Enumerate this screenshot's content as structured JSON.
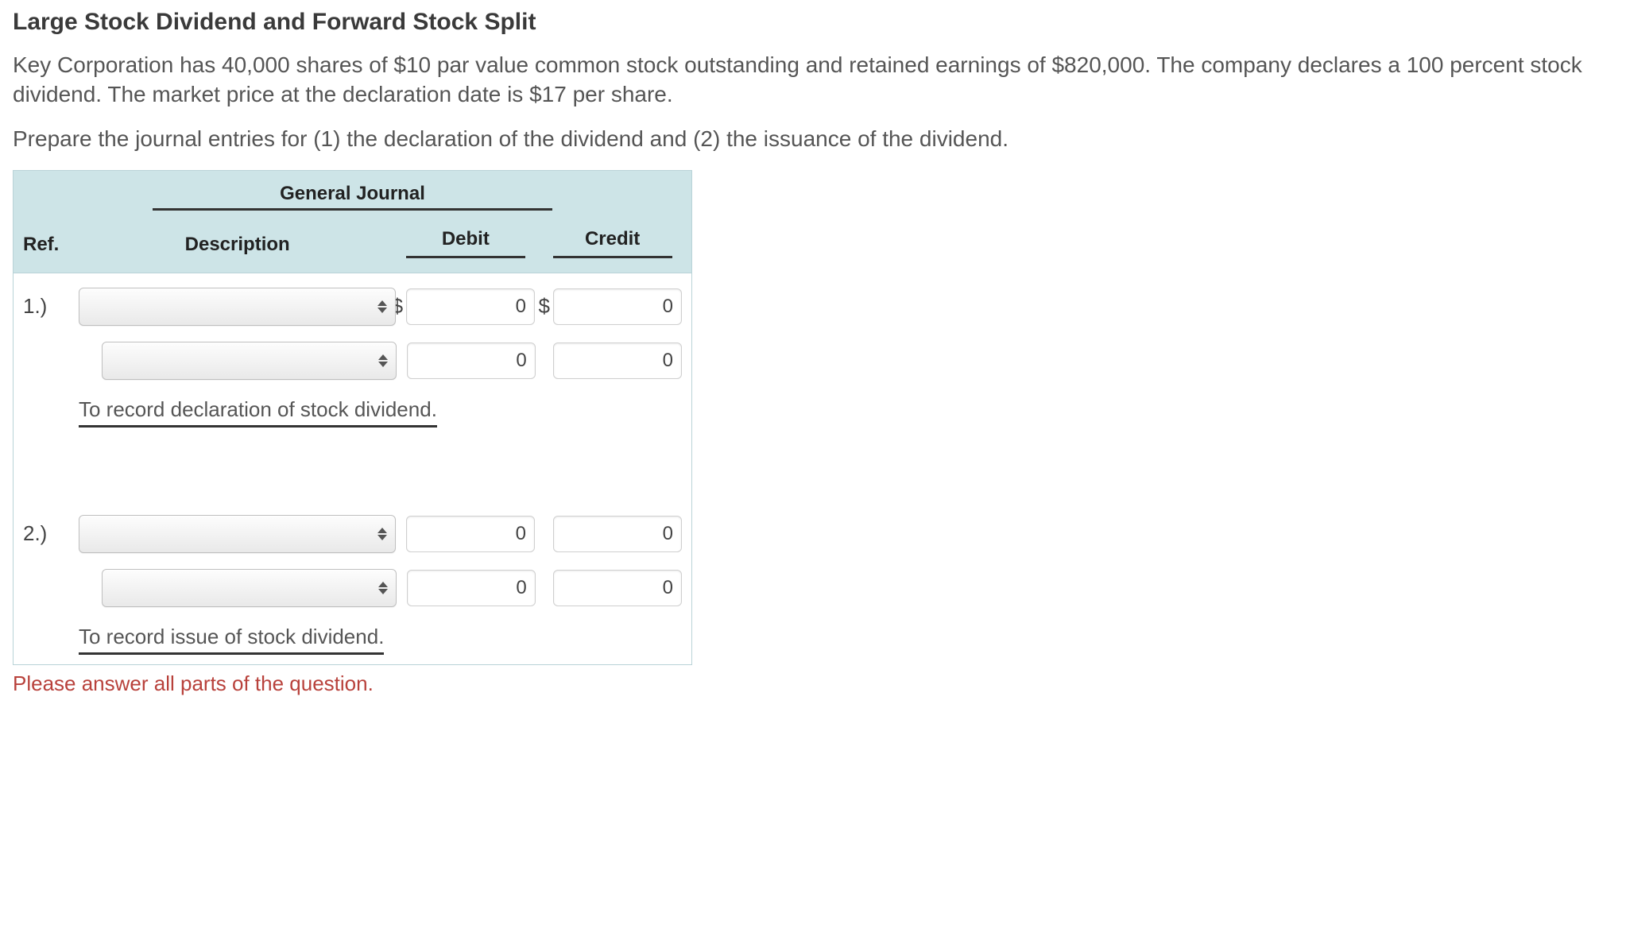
{
  "title": "Large Stock Dividend and Forward Stock Split",
  "paragraph": "Key Corporation has 40,000 shares of $10 par value common stock outstanding and retained earnings of $820,000. The company declares a 100 percent stock dividend. The market price at the declaration date is $17 per share.",
  "instruction": "Prepare the journal entries for (1) the declaration of the dividend and (2) the issuance of the dividend.",
  "journal": {
    "heading": "General Journal",
    "columns": {
      "ref": "Ref.",
      "description": "Description",
      "debit": "Debit",
      "credit": "Credit"
    },
    "currency": "$",
    "entries": [
      {
        "ref_label": "1.)",
        "lines": [
          {
            "account_value": "",
            "debit_value": "0",
            "credit_value": "0",
            "show_currency": true
          },
          {
            "account_value": "",
            "debit_value": "0",
            "credit_value": "0",
            "show_currency": false
          }
        ],
        "note": "To record declaration of stock dividend."
      },
      {
        "ref_label": "2.)",
        "lines": [
          {
            "account_value": "",
            "debit_value": "0",
            "credit_value": "0",
            "show_currency": false
          },
          {
            "account_value": "",
            "debit_value": "0",
            "credit_value": "0",
            "show_currency": false
          }
        ],
        "note": "To record issue of stock dividend."
      }
    ]
  },
  "error_message": "Please answer all parts of the question."
}
